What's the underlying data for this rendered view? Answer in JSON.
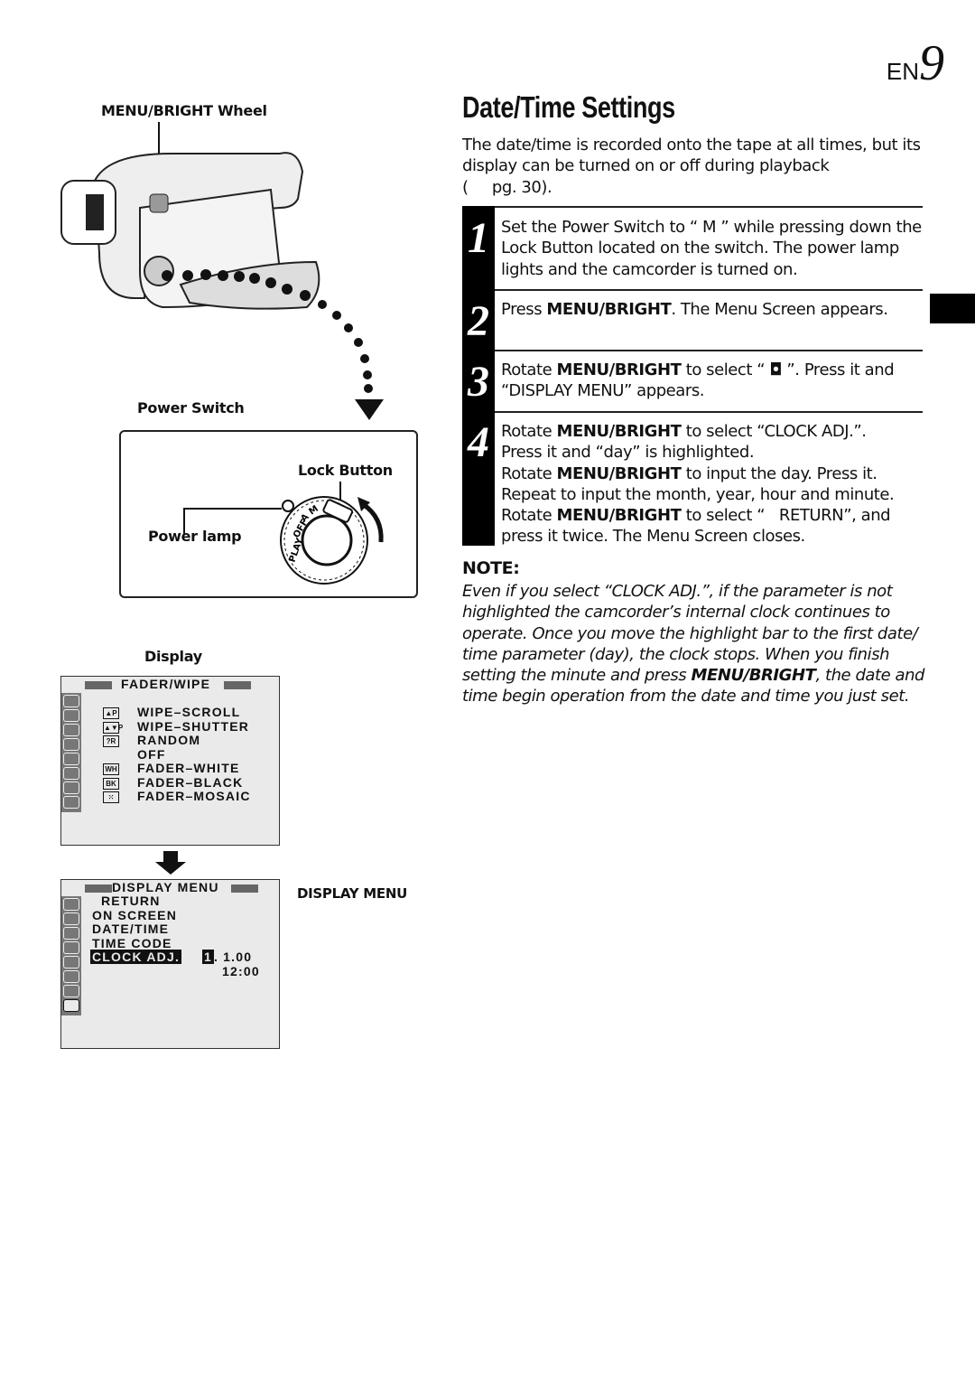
{
  "page_number": {
    "prefix": "EN",
    "number": "9"
  },
  "left": {
    "wheel_label": "MENU/BRIGHT Wheel",
    "power_switch_label": "Power Switch",
    "lock_button_label": "Lock Button",
    "power_lamp_label": "Power lamp",
    "dial_labels": [
      "PLAY",
      "OFF",
      "A",
      "M"
    ],
    "display_label": "Display",
    "display_menu_label": "DISPLAY MENU"
  },
  "screen1": {
    "title": "FADER/WIPE",
    "items": [
      {
        "icon": "▲P",
        "label": "WIPE–SCROLL"
      },
      {
        "icon": "▲▼P",
        "label": "WIPE–SHUTTER"
      },
      {
        "icon": "?R",
        "label": "RANDOM"
      },
      {
        "icon": "",
        "label": "OFF"
      },
      {
        "icon": "WH",
        "label": "FADER–WHITE"
      },
      {
        "icon": "BK",
        "label": "FADER–BLACK"
      },
      {
        "icon": "⁙",
        "label": "FADER–MOSAIC"
      }
    ]
  },
  "screen2": {
    "title": "DISPLAY MENU",
    "items": [
      "RETURN",
      "ON SCREEN",
      "DATE/TIME",
      "TIME CODE"
    ],
    "selected": "CLOCK ADJ.",
    "day": "1",
    "date_rest": ". 1.00",
    "time": "12:00"
  },
  "main": {
    "title": "Date/Time Settings",
    "intro": "The date/time is recorded onto the tape at all times, but its display can be turned on or off during playback",
    "intro_ref": "(     pg. 30).",
    "steps": [
      {
        "num": "1",
        "text": "Set the Power Switch to “ M ” while pressing down the Lock Button located on the switch. The power lamp lights and the camcorder is turned on."
      },
      {
        "num": "2",
        "text_pre": "Press ",
        "bold": "MENU/BRIGHT",
        "text_post": ". The Menu Screen appears."
      },
      {
        "num": "3",
        "line1_pre": "Rotate ",
        "bold": "MENU/BRIGHT",
        "line1_post": " to select “ ◘ ”. Press it and",
        "line2": "“DISPLAY MENU” appears."
      },
      {
        "num": "4",
        "lines": [
          {
            "pre": "Rotate ",
            "bold": "MENU/BRIGHT",
            "post": " to select “CLOCK ADJ.”."
          },
          {
            "pre": "Press it and “day” is highlighted.",
            "bold": "",
            "post": ""
          },
          {
            "pre": "Rotate ",
            "bold": "MENU/BRIGHT",
            "post": " to input the day. Press it."
          },
          {
            "pre": "Repeat to input the month, year, hour and minute.",
            "bold": "",
            "post": ""
          },
          {
            "pre": "Rotate ",
            "bold": "MENU/BRIGHT",
            "post": " to select “   RETURN”, and"
          },
          {
            "pre": "press it twice. The Menu Screen closes.",
            "bold": "",
            "post": ""
          }
        ]
      }
    ],
    "note_heading": "NOTE:",
    "note_pre": "Even if you select “CLOCK ADJ.”, if the parameter is not highlighted the camcorder’s internal clock continues to operate. Once you move the highlight bar to the first date/ time parameter (day), the clock stops. When you finish setting the minute and press ",
    "note_bold": "MENU/BRIGHT",
    "note_post": ", the date and time begin operation from the date and time you just set."
  }
}
